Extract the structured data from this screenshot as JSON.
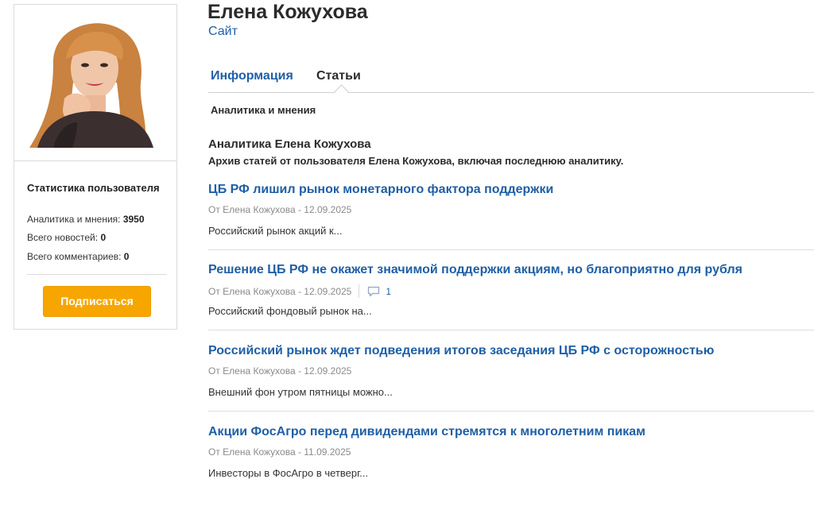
{
  "profile": {
    "name": "Елена Кожухова",
    "site_link": "Сайт"
  },
  "sidebar": {
    "stats_title": "Статистика пользователя",
    "stats": [
      {
        "label": "Аналитика и мнения:",
        "value": "3950"
      },
      {
        "label": "Всего новостей:",
        "value": "0"
      },
      {
        "label": "Всего комментариев:",
        "value": "0"
      }
    ],
    "subscribe_label": "Подписаться"
  },
  "tabs": [
    {
      "label": "Информация",
      "active": false
    },
    {
      "label": "Статьи",
      "active": true
    }
  ],
  "subtab": "Аналитика и мнения",
  "section": {
    "title": "Аналитика Елена Кожухова",
    "description": "Архив статей от пользователя Елена Кожухова, включая последнюю аналитику."
  },
  "articles": [
    {
      "title": "ЦБ РФ лишил рынок монетарного фактора поддержки",
      "meta": "От Елена Кожухова - 12.09.2025",
      "comments": null,
      "excerpt": "Российский рынок акций к..."
    },
    {
      "title": "Решение ЦБ РФ не окажет значимой поддержки акциям, но благоприятно для рубля",
      "meta": "От Елена Кожухова - 12.09.2025",
      "comments": "1",
      "excerpt": "Российский фондовый рынок на..."
    },
    {
      "title": "Российский рынок ждет подведения итогов заседания ЦБ РФ с осторожностью",
      "meta": "От Елена Кожухова - 12.09.2025",
      "comments": null,
      "excerpt": "Внешний фон утром пятницы можно..."
    },
    {
      "title": "Акции ФосАгро перед дивидендами стремятся к многолетним пикам",
      "meta": "От Елена Кожухова - 11.09.2025",
      "comments": null,
      "excerpt": "Инвесторы в ФосАгро в четверг..."
    }
  ],
  "colors": {
    "link": "#1f5fa6",
    "button": "#f7a600",
    "text": "#2b2b2b"
  }
}
